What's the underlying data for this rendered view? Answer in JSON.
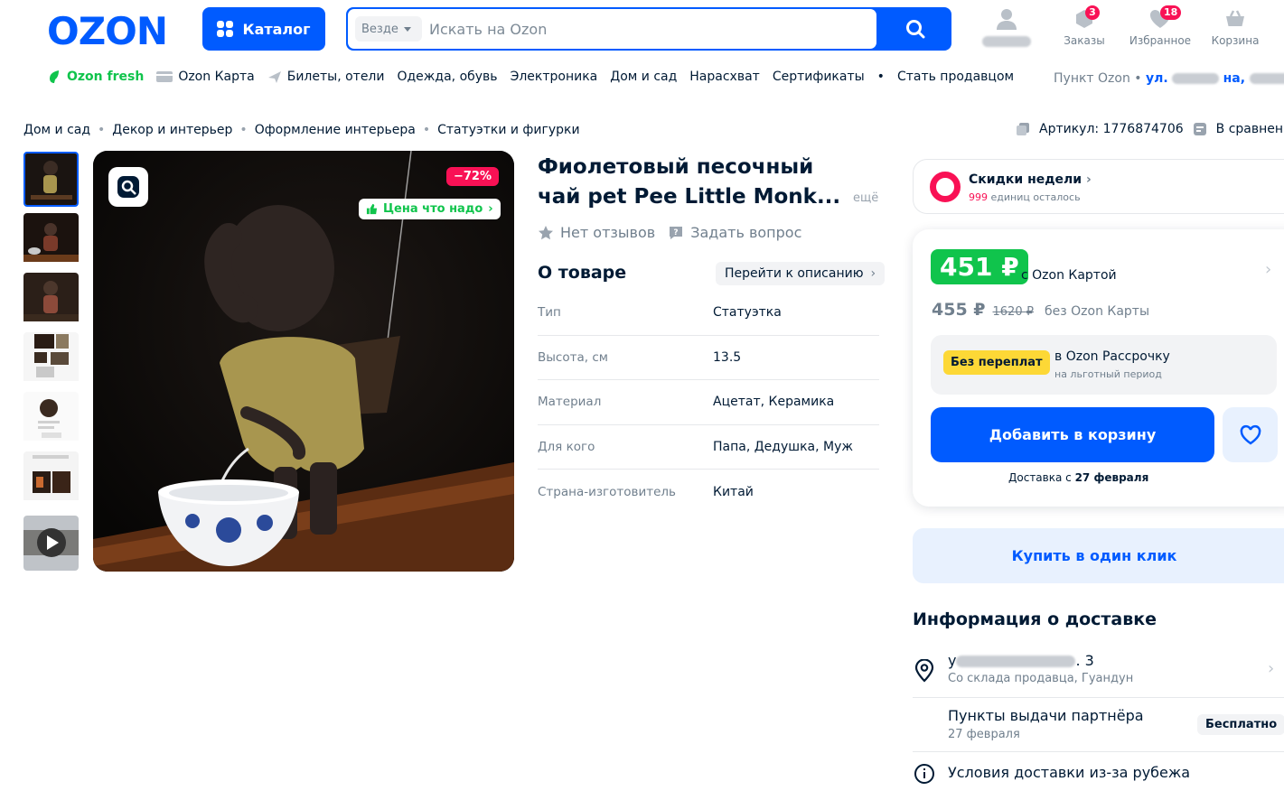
{
  "header": {
    "logo": "OZON",
    "catalog_label": "Каталог",
    "search_scope": "Везде",
    "search_placeholder": "Искать на Ozon",
    "icons": [
      {
        "label": "",
        "name": "profile"
      },
      {
        "label": "Заказы",
        "badge": "3"
      },
      {
        "label": "Избранное",
        "badge": "18"
      },
      {
        "label": "Корзина"
      }
    ]
  },
  "nav": {
    "items": [
      "Ozon fresh",
      "Ozon Карта",
      "Билеты, отели",
      "Одежда, обувь",
      "Электроника",
      "Дом и сад",
      "Нарасхват",
      "Сертификаты",
      "•",
      "Стать продавцом"
    ],
    "pickup_label": "Пункт Ozon",
    "pickup_address_start": "ул.",
    "pickup_address_mid": "на,"
  },
  "breadcrumbs": [
    "Дом и сад",
    "Декор и интерьер",
    "Оформление интерьера",
    "Статуэтки и фигурки"
  ],
  "article": {
    "label": "Артикул: 1776874706",
    "compare": "В сравнение"
  },
  "gallery": {
    "discount": "−72%",
    "good_price": "Цена что надо",
    "thumb_count": 7
  },
  "product": {
    "title": "Фиолетовый песочный чай pet Pee Little Monk...",
    "more": "ещё",
    "reviews": "Нет отзывов",
    "ask": "Задать вопрос",
    "about_title": "О товаре",
    "to_description": "Перейти к описанию",
    "specs": [
      {
        "key": "Тип",
        "value": "Статуэтка"
      },
      {
        "key": "Высота, см",
        "value": "13.5"
      },
      {
        "key": "Материал",
        "value": "Ацетат, Керамика"
      },
      {
        "key": "Для кого",
        "value": "Папа, Дедушка, Муж"
      },
      {
        "key": "Страна-изготовитель",
        "value": "Китай"
      }
    ]
  },
  "offer": {
    "weekly_title": "Скидки недели",
    "weekly_count": "999",
    "weekly_left": "единиц осталось",
    "card_price": "451 ₽",
    "card_label": "с Ozon Картой",
    "price": "455 ₽",
    "old_price": "1620 ₽",
    "no_card_label": "без Ozon Карты",
    "installment_badge": "Без переплат",
    "installment_title": "в Ozon Рассрочку",
    "installment_sub": "на льготный период",
    "add_to_cart": "Добавить в корзину",
    "delivery_prefix": "Доставка с",
    "delivery_date": "27 февраля",
    "one_click": "Купить в один клик"
  },
  "delivery": {
    "title": "Информация о доставке",
    "address_start": "у",
    "address_end": ". 3",
    "warehouse": "Со склада продавца, Гуандун",
    "partner_points": "Пункты выдачи партнёра",
    "partner_date": "27 февраля",
    "partner_price": "Бесплатно",
    "abroad": "Условия доставки из-за рубежа"
  },
  "colors": {
    "brand": "#005bff",
    "green": "#10c44c",
    "red": "#f91155",
    "yellow": "#fdd836"
  }
}
